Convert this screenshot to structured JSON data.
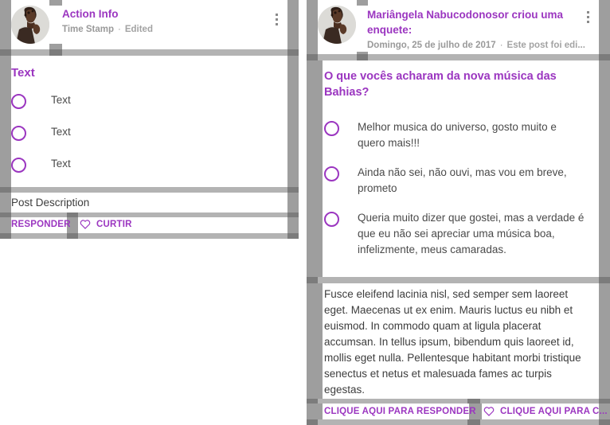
{
  "accent_color": "#9b36c0",
  "gutter_color": "#9e9e9e",
  "gutter_dark_color": "#7c7c7c",
  "gutter_light_color": "#b3b3b3",
  "body_text_color": "#3d3d3d",
  "muted_text_color": "#9a9a9a",
  "template_card": {
    "avatar_name": "user-avatar-photo",
    "header": {
      "action_info": "Action Info",
      "timestamp": "Time Stamp",
      "separator": "·",
      "edited": "Edited"
    },
    "overflow_menu_name": "more-options-icon",
    "poll": {
      "question": "Text",
      "options": [
        {
          "label": "Text"
        },
        {
          "label": "Text"
        },
        {
          "label": "Text"
        }
      ]
    },
    "description": "Post Description",
    "actions": {
      "reply_label": "RESPONDER",
      "like_label": "CURTIR",
      "like_icon": "heart-icon"
    }
  },
  "example_card": {
    "avatar_name": "user-avatar-photo",
    "header": {
      "author": "Mariângela Nabucodonosor",
      "action_suffix": " criou uma enquete:",
      "timestamp": "Domingo, 25 de julho de 2017",
      "separator": "·",
      "edited": "Este post foi edi..."
    },
    "overflow_menu_name": "more-options-icon",
    "poll": {
      "question": "O que vocês acharam da nova música das Bahias?",
      "options": [
        {
          "label": "Melhor musica do universo, gosto muito e quero mais!!!"
        },
        {
          "label": "Ainda não sei, não ouvi, mas vou em breve, prometo"
        },
        {
          "label": "Queria muito dizer que gostei, mas a verdade é que eu não sei apreciar uma música boa, infelizmente, meus camaradas."
        }
      ]
    },
    "description": "Fusce eleifend lacinia nisl, sed semper sem laoreet eget. Maecenas ut ex enim. Mauris luctus eu nibh et euismod. In commodo quam at ligula placerat accumsan. In tellus ipsum, bibendum quis laoreet id, mollis eget nulla. Pellentesque habitant morbi tristique senectus et netus et malesuada fames ac turpis egestas.",
    "actions": {
      "reply_label": "CLIQUE AQUI PARA RESPONDER",
      "like_label": "CLIQUE AQUI PARA C...",
      "like_icon": "heart-icon"
    }
  }
}
